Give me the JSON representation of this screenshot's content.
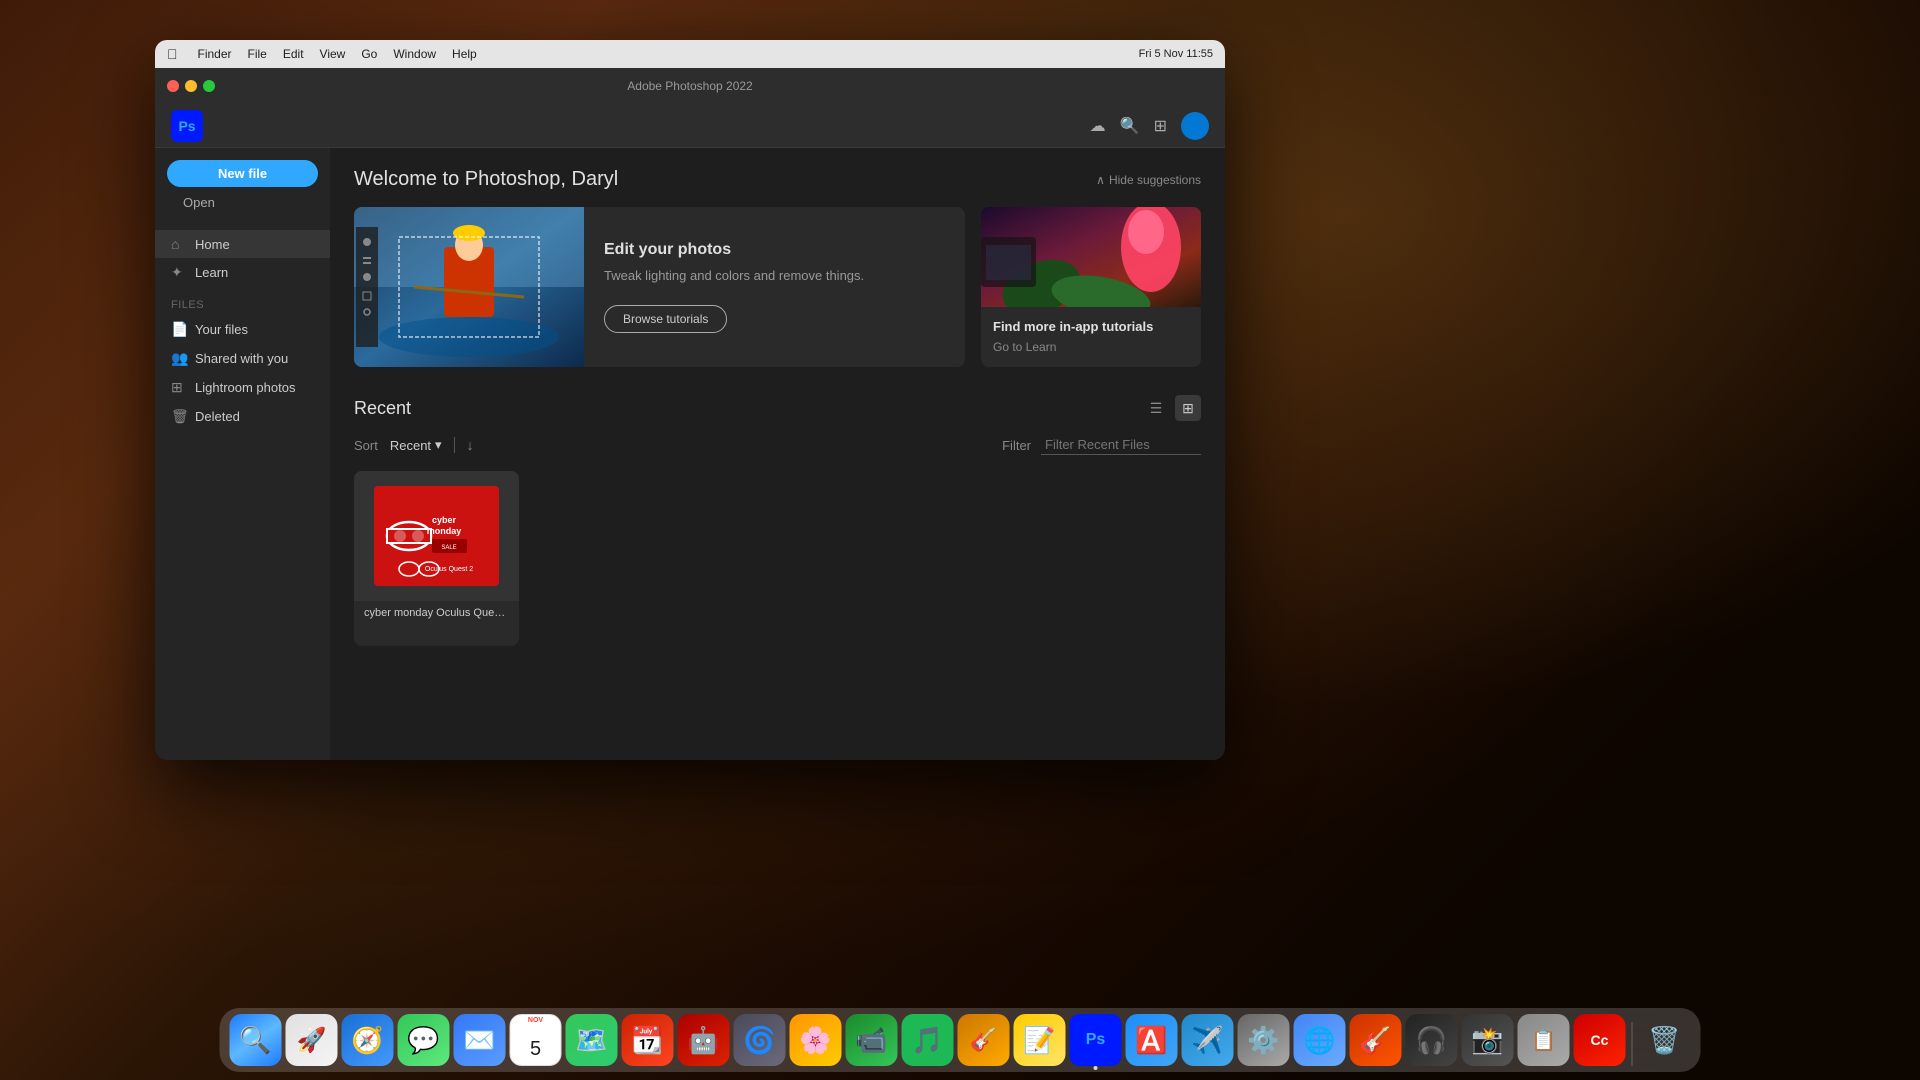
{
  "desktop": {
    "bg_color": "#1a0a00"
  },
  "mac_menubar": {
    "menus": [
      "Finder",
      "File",
      "Edit",
      "View",
      "Go",
      "Window",
      "Help"
    ],
    "time": "Fri 5 Nov 11:55"
  },
  "ps_window": {
    "title": "Adobe Photoshop 2022",
    "traffic_lights": {
      "close": "●",
      "min": "●",
      "max": "●"
    }
  },
  "ps_header": {
    "logo": "Ps",
    "icons": [
      "cloud-icon",
      "search-icon",
      "plugin-icon",
      "avatar-icon"
    ]
  },
  "sidebar": {
    "new_file_label": "New file",
    "open_label": "Open",
    "nav_items": [
      {
        "id": "home",
        "label": "Home",
        "icon": "🏠",
        "active": true
      },
      {
        "id": "learn",
        "label": "Learn",
        "icon": "✦"
      }
    ],
    "files_section_label": "FILES",
    "file_items": [
      {
        "id": "your-files",
        "label": "Your files",
        "icon": "📄"
      },
      {
        "id": "shared",
        "label": "Shared with you",
        "icon": "👥"
      },
      {
        "id": "lightroom",
        "label": "Lightroom photos",
        "icon": "🔲"
      },
      {
        "id": "deleted",
        "label": "Deleted",
        "icon": "🗑"
      }
    ]
  },
  "main_content": {
    "welcome_title": "Welcome to Photoshop, Daryl",
    "hide_suggestions_label": "Hide suggestions",
    "suggestion_cards": [
      {
        "id": "edit-photos",
        "title": "Edit your photos",
        "description": "Tweak lighting and colors and remove things.",
        "button_label": "Browse tutorials"
      },
      {
        "id": "tutorials",
        "title": "Find more in-app tutorials",
        "go_to_label": "Go to Learn"
      }
    ],
    "recent_section": {
      "title": "Recent",
      "sort_label": "Sort",
      "sort_value": "Recent",
      "filter_label": "Filter",
      "filter_placeholder": "Filter Recent Files",
      "files": [
        {
          "name": "cyber monday Oculus Quest 2",
          "type": "psd"
        }
      ]
    }
  },
  "dock": {
    "apps": [
      {
        "id": "finder",
        "label": "Finder",
        "color": "#1e7aff",
        "emoji": "🔍"
      },
      {
        "id": "launchpad",
        "label": "Launchpad",
        "color": "#f5f5f5",
        "emoji": "🚀"
      },
      {
        "id": "safari",
        "label": "Safari",
        "color": "#006cff",
        "emoji": "🧭"
      },
      {
        "id": "messages",
        "label": "Messages",
        "color": "#34c759",
        "emoji": "💬"
      },
      {
        "id": "mail",
        "label": "Mail",
        "color": "#3478f6",
        "emoji": "✉️"
      },
      {
        "id": "calendar",
        "label": "Calendar",
        "color": "#ff3b30",
        "emoji": "📅"
      },
      {
        "id": "maps",
        "label": "Maps",
        "color": "#34c759",
        "emoji": "🗺️"
      },
      {
        "id": "fantastical",
        "label": "Fantastical",
        "color": "#ff3b30",
        "emoji": "📆"
      },
      {
        "id": "android-file",
        "label": "Android File Transfer",
        "color": "#78c800",
        "emoji": "🤖"
      },
      {
        "id": "compressor",
        "label": "Compressor",
        "color": "#aaa",
        "emoji": "⚙️"
      },
      {
        "id": "photos",
        "label": "Photos",
        "color": "#ff9500",
        "emoji": "🌸"
      },
      {
        "id": "facetime",
        "label": "FaceTime",
        "color": "#34c759",
        "emoji": "📹"
      },
      {
        "id": "spotify",
        "label": "Spotify",
        "color": "#1db954",
        "emoji": "🎵"
      },
      {
        "id": "capo",
        "label": "Capo",
        "color": "#ff9500",
        "emoji": "🎸"
      },
      {
        "id": "notes",
        "label": "Notes",
        "color": "#ffcc00",
        "emoji": "📝"
      },
      {
        "id": "photoshop",
        "label": "Photoshop",
        "color": "#001aff",
        "emoji": "Ps",
        "running": true
      },
      {
        "id": "appstore",
        "label": "App Store",
        "color": "#1c8ef9",
        "emoji": "🅰"
      },
      {
        "id": "testflight",
        "label": "TestFlight",
        "color": "#34aadc",
        "emoji": "✈️"
      },
      {
        "id": "systemprefs",
        "label": "System Preferences",
        "color": "#888",
        "emoji": "⚙️"
      },
      {
        "id": "chrome",
        "label": "Chrome",
        "color": "#4285f4",
        "emoji": "🌐"
      },
      {
        "id": "garageband",
        "label": "GarageBand",
        "color": "#ff5c00",
        "emoji": "🎸"
      },
      {
        "id": "headphones",
        "label": "Headphone app",
        "color": "#333",
        "emoji": "🎧"
      },
      {
        "id": "screencapture",
        "label": "Screenshot",
        "color": "#555",
        "emoji": "📸"
      },
      {
        "id": "clipper",
        "label": "Clipper",
        "color": "#aaa",
        "emoji": "📋"
      },
      {
        "id": "adobe-cc",
        "label": "Adobe CC",
        "color": "#ff0000",
        "emoji": "Cc"
      },
      {
        "id": "trash",
        "label": "Trash",
        "color": "#888",
        "emoji": "🗑️"
      }
    ]
  }
}
